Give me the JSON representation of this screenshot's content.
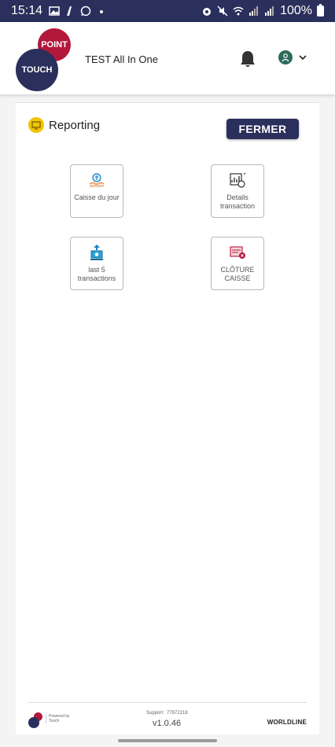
{
  "status_bar": {
    "time": "15:14",
    "battery": "100%"
  },
  "header": {
    "logo_top": "POINT",
    "logo_bottom": "TOUCH",
    "title": "TEST All In One"
  },
  "section": {
    "title": "Reporting",
    "close_label": "FERMER"
  },
  "tiles": [
    {
      "label": "Caisse du jour",
      "icon": "cash-hands-icon"
    },
    {
      "label": "Details transaction",
      "icon": "report-chart-icon"
    },
    {
      "label": "last 5 transactions",
      "icon": "upload-money-icon"
    },
    {
      "label": "CLÔTURE CAISSE",
      "icon": "closing-register-icon"
    }
  ],
  "footer": {
    "powered_line1": "Powered by",
    "powered_line2": "Touch",
    "support": "Support : 77872218",
    "version": "v1.0.46",
    "brand": "WORLDLINE"
  },
  "colors": {
    "primary": "#2a2f5b",
    "accent": "#b3183c",
    "section_icon": "#f2c500"
  }
}
